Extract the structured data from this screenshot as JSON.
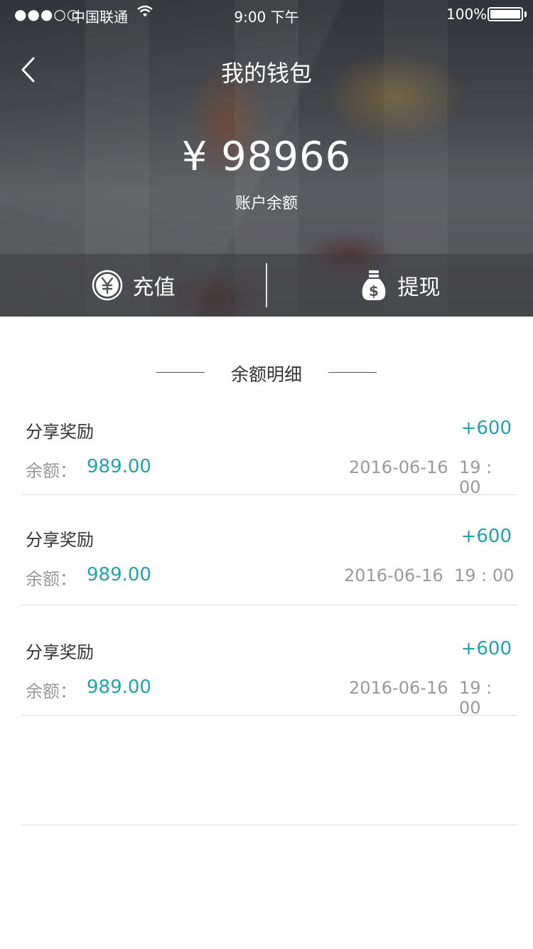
{
  "status": {
    "signal": "●●●○○",
    "carrier": "中国联通",
    "time": "9:00 下午",
    "battery": "100%"
  },
  "nav": {
    "title": "我的钱包",
    "back_icon": "chevron-left-icon"
  },
  "wallet": {
    "balance": "¥ 98966",
    "balance_label": "账户余额"
  },
  "actions": [
    {
      "label": "充值",
      "icon": "yen-coin-icon"
    },
    {
      "label": "提现",
      "icon": "money-bag-icon"
    }
  ],
  "section": {
    "title": "余额明细"
  },
  "records": [
    {
      "title": "分享奖励",
      "amount": "+600",
      "balance_label": "余额：",
      "balance_value": "989.00",
      "date": "2016-06-16",
      "time": "19 : 00"
    },
    {
      "title": "分享奖励",
      "amount": "+600",
      "balance_label": "余额：",
      "balance_value": "989.00",
      "date": "2016-06-16",
      "time": "19 : 00"
    },
    {
      "title": "分享奖励",
      "amount": "+600",
      "balance_label": "余额：",
      "balance_value": "989.00",
      "date": "2016-06-16",
      "time": "19 : 00"
    }
  ],
  "colors": {
    "accent": "#1ea4ae",
    "text_primary": "#333333",
    "text_secondary": "#999999",
    "divider": "#dddddd"
  }
}
